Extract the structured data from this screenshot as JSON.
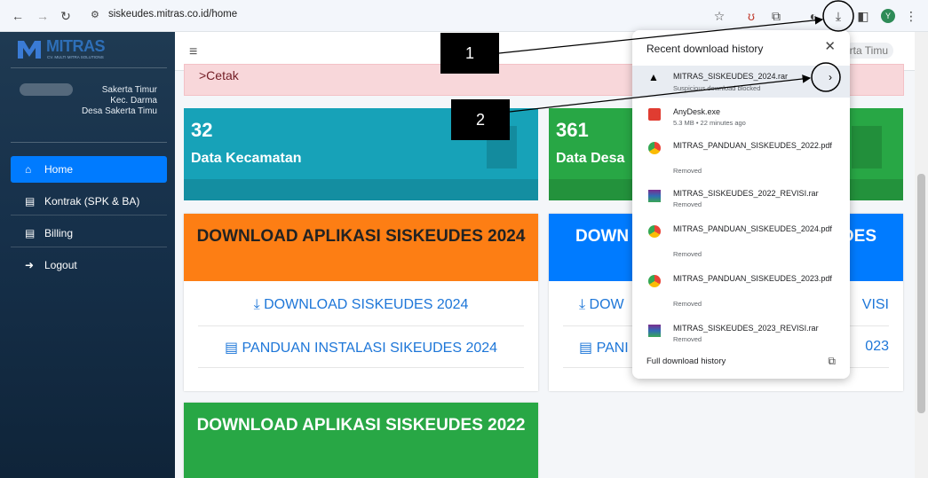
{
  "browser": {
    "url": "siskeudes.mitras.co.id/home",
    "profile_initial": "Y"
  },
  "logo": {
    "text": "MITRAS",
    "sub": "CV. MULTI MITRA SOLUTIONS"
  },
  "user": {
    "line1": "Sakerta Timur",
    "line2": "Kec. Darma",
    "line3": "Desa Sakerta Timu"
  },
  "topbar": {
    "user_name": "rta Timu"
  },
  "sidebar": {
    "items": [
      {
        "label": "Home"
      },
      {
        "label": "Kontrak (SPK & BA)"
      },
      {
        "label": "Billing"
      },
      {
        "label": "Logout"
      }
    ]
  },
  "alert": {
    "text": ">Cetak"
  },
  "stats": [
    {
      "value": "32",
      "label": "Data Kecamatan",
      "color": "#17a2b8"
    },
    {
      "value": "361",
      "label": "Data Desa",
      "color": "#28a745"
    }
  ],
  "cards": [
    {
      "title": "DOWNLOAD APLIKASI SISKEUDES 2024",
      "link1": "DOWNLOAD SISKEUDES 2024",
      "link2": "PANDUAN INSTALASI SIKEUDES 2024",
      "color": "#fd7e14"
    },
    {
      "title_partial": "DOWN",
      "title_tail": "DES",
      "link1_partial": "DOW",
      "link1_tail": "VISI",
      "link2_partial": "PANI",
      "link2_tail": "023",
      "color": "#007bff"
    },
    {
      "title": "DOWNLOAD APLIKASI SISKEUDES 2022",
      "color": "#28a745"
    }
  ],
  "downloads": {
    "title": "Recent download history",
    "footer": "Full download history",
    "items": [
      {
        "name": "MITRAS_SISKEUDES_2024.rar",
        "status": "Suspicious download blocked",
        "icon": "warning-icon"
      },
      {
        "name": "AnyDesk.exe",
        "status": "5.3 MB • 22 minutes ago",
        "icon": "anydesk-icon"
      },
      {
        "name": "MITRAS_PANDUAN_SISKEUDES_2022.pdf",
        "status": "Removed",
        "icon": "chrome-icon"
      },
      {
        "name": "MITRAS_SISKEUDES_2022_REVISI.rar",
        "status": "Removed",
        "icon": "archive-icon"
      },
      {
        "name": "MITRAS_PANDUAN_SISKEUDES_2024.pdf",
        "status": "Removed",
        "icon": "chrome-icon"
      },
      {
        "name": "MITRAS_PANDUAN_SISKEUDES_2023.pdf",
        "status": "Removed",
        "icon": "chrome-icon"
      },
      {
        "name": "MITRAS_SISKEUDES_2023_REVISI.rar",
        "status": "Removed",
        "icon": "archive-icon"
      }
    ]
  },
  "annotations": {
    "one": "1",
    "two": "2"
  }
}
